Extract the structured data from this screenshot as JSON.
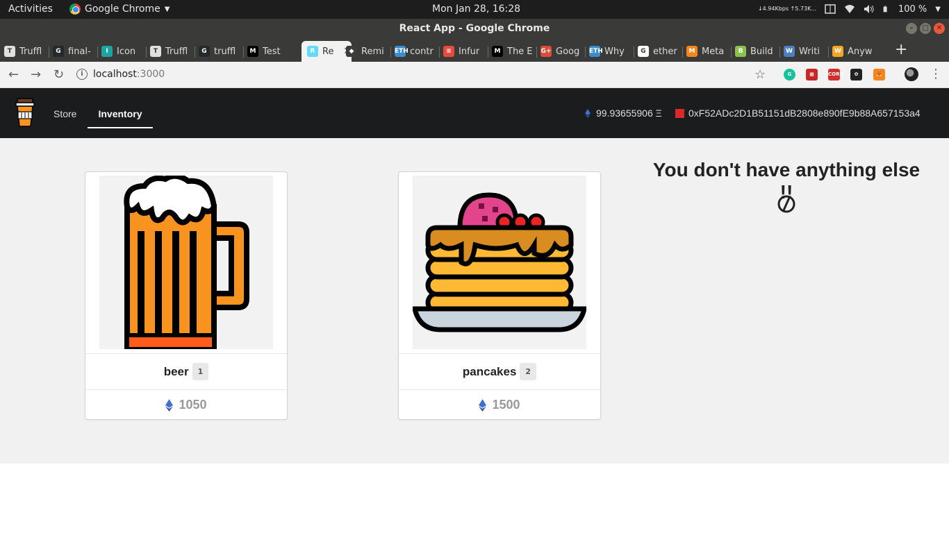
{
  "os_bar": {
    "activities": "Activities",
    "app_name": "Google Chrome",
    "clock": "Mon Jan 28, 16:28",
    "net_speed": "↓4.94Kbps ↑5.73K...",
    "battery": "100 %"
  },
  "window": {
    "title": "React App - Google Chrome"
  },
  "tabs": [
    {
      "label": "Truffl",
      "color": "#e0e0e0",
      "glyph": "T"
    },
    {
      "label": "final-",
      "color": "#24292e",
      "glyph": "G"
    },
    {
      "label": "Icon",
      "color": "#1ea3a3",
      "glyph": "I"
    },
    {
      "label": "Truffl",
      "color": "#e0e0e0",
      "glyph": "T"
    },
    {
      "label": "truffl",
      "color": "#24292e",
      "glyph": "G"
    },
    {
      "label": "Test",
      "color": "#000000",
      "glyph": "M"
    },
    {
      "label": "Re",
      "color": "#61dafb",
      "glyph": "R"
    },
    {
      "label": "Remi",
      "color": "#3c3c3d",
      "glyph": "◆"
    },
    {
      "label": "contr",
      "color": "#3c8dcf",
      "glyph": "ETH"
    },
    {
      "label": "Infur",
      "color": "#e84b3c",
      "glyph": "≡"
    },
    {
      "label": "The E",
      "color": "#000000",
      "glyph": "M"
    },
    {
      "label": "Goog",
      "color": "#dd4b39",
      "glyph": "G+"
    },
    {
      "label": "Why",
      "color": "#3c8dcf",
      "glyph": "ETH"
    },
    {
      "label": "ether",
      "color": "#ffffff",
      "glyph": "G"
    },
    {
      "label": "Meta",
      "color": "#f6851b",
      "glyph": "M"
    },
    {
      "label": "Build",
      "color": "#8bc34a",
      "glyph": "B"
    },
    {
      "label": "Writi",
      "color": "#4a7fc1",
      "glyph": "W"
    },
    {
      "label": "Anyw",
      "color": "#f5a623",
      "glyph": "W"
    }
  ],
  "address_bar": {
    "host": "localhost",
    "port": ":3000"
  },
  "extensions": [
    {
      "name": "grammarly-icon",
      "color": "#15c39a",
      "glyph": "G"
    },
    {
      "name": "ext-red-icon",
      "color": "#c62828",
      "glyph": "▦"
    },
    {
      "name": "cors-icon",
      "color": "#d32f2f",
      "glyph": "CORS"
    },
    {
      "name": "gnome-icon",
      "color": "#222222",
      "glyph": "✿"
    },
    {
      "name": "metamask-icon",
      "color": "#f6851b",
      "glyph": "🦊"
    }
  ],
  "app": {
    "nav": {
      "store": "Store",
      "inventory": "Inventory"
    },
    "balance": "99.93655906 Ξ",
    "account": "0xF52ADc2D1B51151dB2808e890fE9b88A657153a4"
  },
  "items": [
    {
      "name": "beer",
      "quantity": "1",
      "price": "1050"
    },
    {
      "name": "pancakes",
      "quantity": "2",
      "price": "1500"
    }
  ],
  "empty_message": "You don't have anything else !!"
}
